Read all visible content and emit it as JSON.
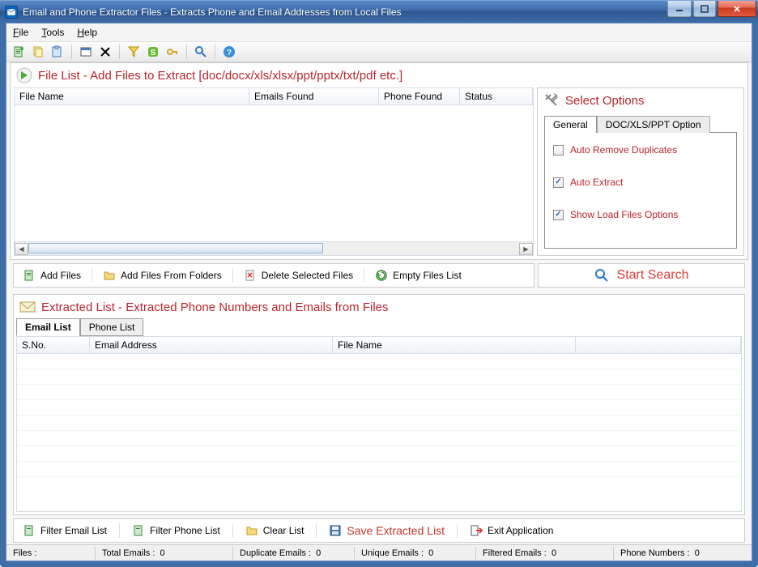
{
  "window": {
    "title": "Email and Phone Extractor Files  -  Extracts Phone and Email Addresses from Local Files"
  },
  "menu": {
    "file": "File",
    "tools": "Tools",
    "help": "Help"
  },
  "toolbar_icons": [
    "new-scan",
    "copy",
    "paste",
    "window",
    "delete",
    "funnel",
    "skype",
    "key",
    "search",
    "help"
  ],
  "file_panel": {
    "title": "File List - Add Files to Extract  [doc/docx/xls/xlsx/ppt/pptx/txt/pdf etc.]",
    "columns": {
      "filename": "File Name",
      "emails": "Emails Found",
      "phone": "Phone Found",
      "status": "Status"
    }
  },
  "options": {
    "title": "Select Options",
    "tabs": {
      "general": "General",
      "doc": "DOC/XLS/PPT Option"
    },
    "auto_remove_dup": {
      "label": "Auto Remove Duplicates",
      "checked": false
    },
    "auto_extract": {
      "label": "Auto Extract",
      "checked": true
    },
    "show_load": {
      "label": "Show Load Files Options",
      "checked": true
    }
  },
  "actions": {
    "add_files": "Add Files",
    "add_from_folders": "Add Files From Folders",
    "delete_selected": "Delete Selected Files",
    "empty_list": "Empty Files List",
    "start_search": "Start Search"
  },
  "extracted": {
    "title": "Extracted List - Extracted Phone Numbers and Emails from Files",
    "tabs": {
      "email": "Email List",
      "phone": "Phone List"
    },
    "columns": {
      "sno": "S.No.",
      "email": "Email Address",
      "file": "File Name"
    }
  },
  "bottom": {
    "filter_email": "Filter Email List",
    "filter_phone": "Filter Phone List",
    "clear_list": "Clear List",
    "save_list": "Save Extracted List",
    "exit": "Exit Application"
  },
  "status": {
    "files_lbl": "Files :",
    "total_emails_lbl": "Total Emails :",
    "total_emails": "0",
    "dup_emails_lbl": "Duplicate Emails :",
    "dup_emails": "0",
    "unique_emails_lbl": "Unique Emails :",
    "unique_emails": "0",
    "filtered_emails_lbl": "Filtered Emails :",
    "filtered_emails": "0",
    "phone_lbl": "Phone Numbers :",
    "phone": "0"
  }
}
